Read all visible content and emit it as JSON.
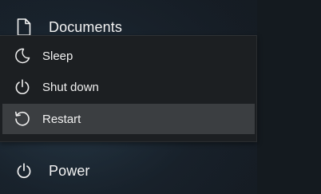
{
  "rail": {
    "documents": {
      "label": "Documents",
      "icon": "document-icon"
    },
    "power": {
      "label": "Power",
      "icon": "power-icon"
    }
  },
  "power_menu": {
    "items": [
      {
        "label": "Sleep",
        "icon": "moon-icon"
      },
      {
        "label": "Shut down",
        "icon": "power-icon"
      },
      {
        "label": "Restart",
        "icon": "restart-icon",
        "highlighted": true
      }
    ]
  },
  "colors": {
    "flyout_background": "#1c1f22",
    "hover_highlight": "#3b3e41",
    "text": "#f2f2f2"
  }
}
